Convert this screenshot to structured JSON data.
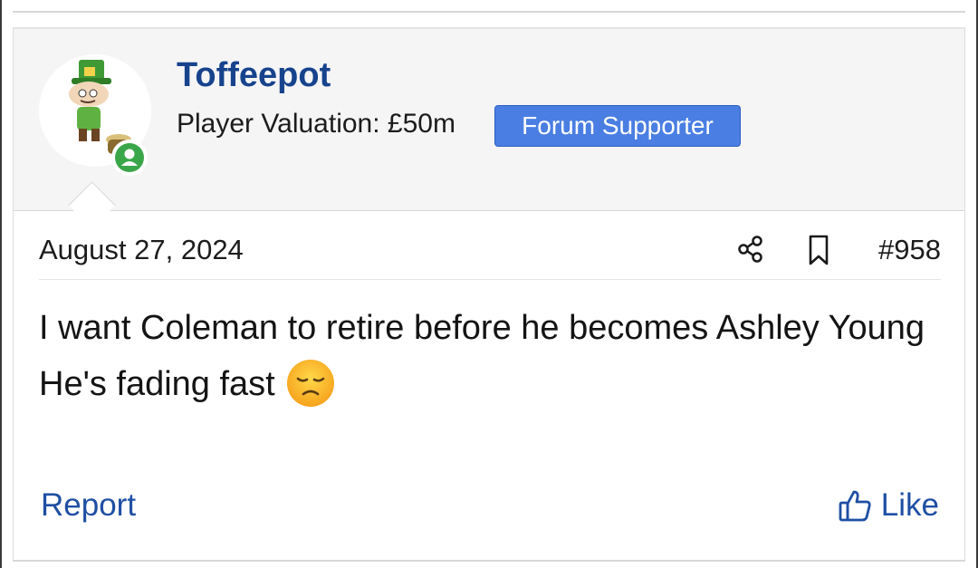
{
  "post": {
    "username": "Toffeepot",
    "valuation": "Player Valuation: £50m",
    "badge": "Forum Supporter",
    "date": "August 27, 2024",
    "post_number": "#958",
    "message_line1": "I want Coleman to retire before he becomes Ashley Young",
    "message_line2": "He's fading fast",
    "emoji_icon": "pensive-face-icon",
    "online_icon": "online-user-icon",
    "share_icon": "share-icon",
    "bookmark_icon": "bookmark-icon",
    "like_icon": "thumbs-up-icon",
    "report_label": "Report",
    "like_label": "Like"
  },
  "colors": {
    "username": "#17438d",
    "badge_bg": "#4a7ee3",
    "link": "#1f4fa3",
    "online": "#3aa64a",
    "header_bg": "#f5f5f5"
  }
}
